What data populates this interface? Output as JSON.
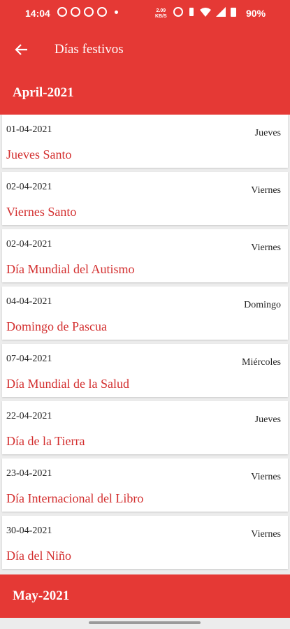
{
  "status_bar": {
    "time": "14:04",
    "net_speed_value": "2.09",
    "net_speed_unit": "KB/S",
    "battery": "90%"
  },
  "app_bar": {
    "title": "Días festivos",
    "back_icon": "arrow-left-icon"
  },
  "sections": [
    {
      "month": "April-2021",
      "holidays": [
        {
          "date": "01-04-2021",
          "weekday": "Jueves",
          "name": "Jueves Santo"
        },
        {
          "date": "02-04-2021",
          "weekday": "Viernes",
          "name": "Viernes Santo"
        },
        {
          "date": "02-04-2021",
          "weekday": "Viernes",
          "name": "Día Mundial del Autismo"
        },
        {
          "date": "04-04-2021",
          "weekday": "Domingo",
          "name": "Domingo de Pascua"
        },
        {
          "date": "07-04-2021",
          "weekday": "Miércoles",
          "name": "Día Mundial de la Salud"
        },
        {
          "date": "22-04-2021",
          "weekday": "Jueves",
          "name": "Día de la Tierra"
        },
        {
          "date": "23-04-2021",
          "weekday": "Viernes",
          "name": "Día Internacional del Libro"
        },
        {
          "date": "30-04-2021",
          "weekday": "Viernes",
          "name": "Día del Niño"
        }
      ]
    },
    {
      "month": "May-2021",
      "holidays": []
    }
  ],
  "colors": {
    "primary": "#e53935",
    "holiday_name": "#d32f2f",
    "background": "#ececec"
  }
}
